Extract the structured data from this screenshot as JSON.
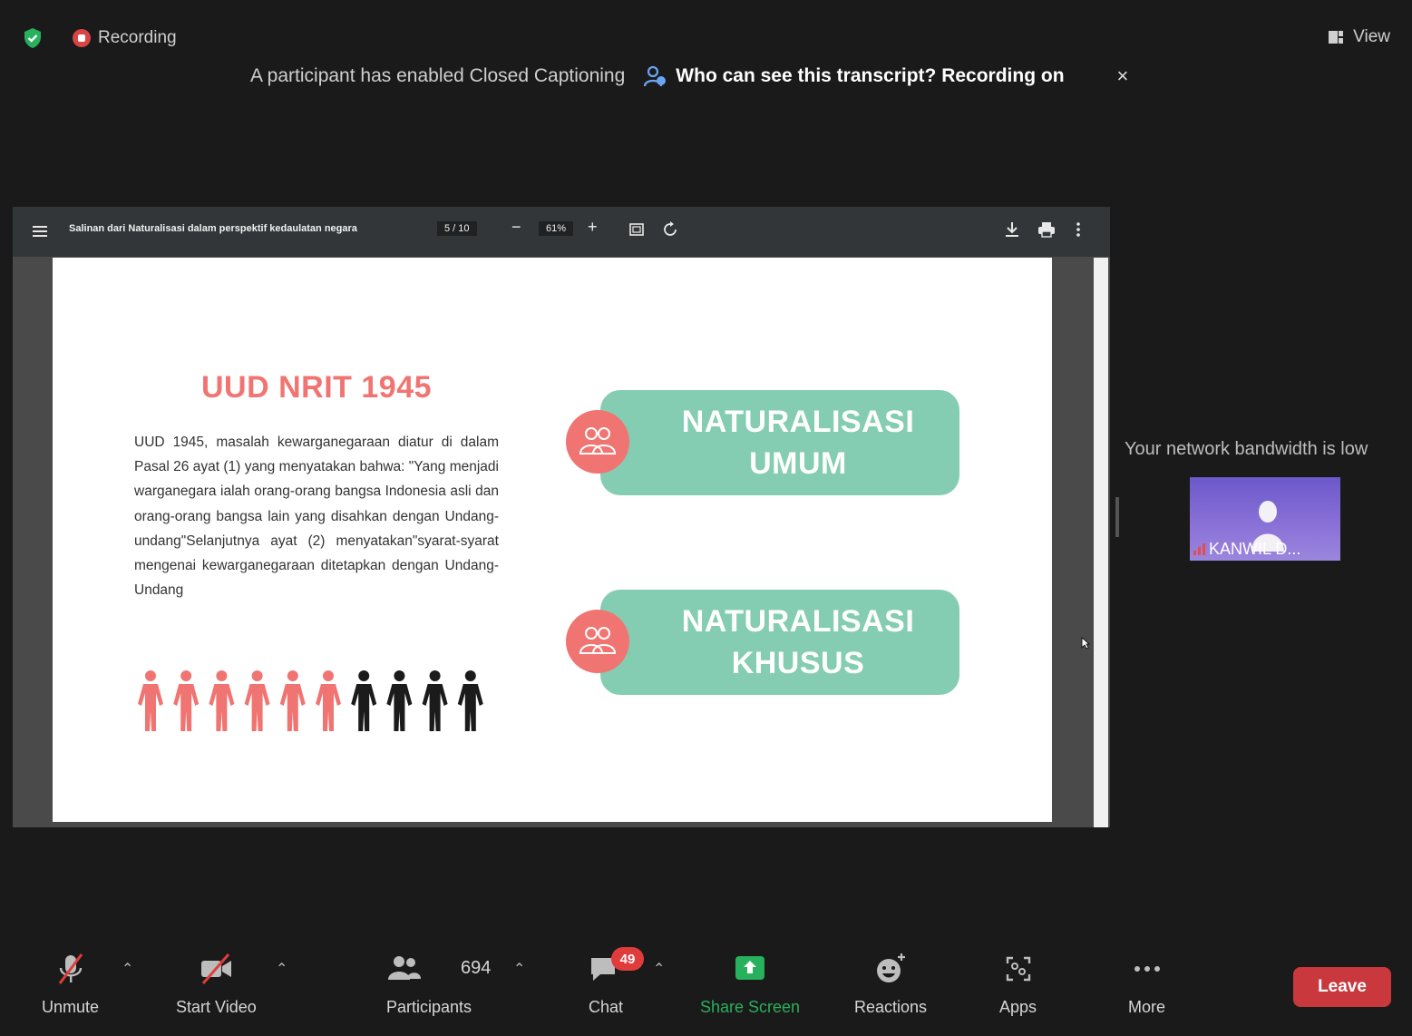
{
  "top": {
    "recording_label": "Recording",
    "view_label": "View",
    "caption_notice": "A participant has enabled Closed Captioning",
    "transcript_link": "Who can see this transcript? Recording on",
    "close_glyph": "×"
  },
  "pdf_viewer": {
    "file_name": "Salinan dari Naturalisasi dalam perspektif kedaulatan negara",
    "page_indicator": "5 / 10",
    "zoom": "61%",
    "minus": "−",
    "plus": "+"
  },
  "slide": {
    "title": "UUD NRIT 1945",
    "body": "UUD 1945, masalah kewarganegaraan diatur di dalam Pasal 26 ayat (1) yang menyatakan bahwa: \"Yang menjadi warganegara ialah orang-orang bangsa Indonesia asli dan orang-orang bangsa lain yang disahkan dengan Undang-undang\"Selanjutnya ayat (2) menyatakan\"syarat-syarat mengenai kewarganegaraan ditetapkan dengan Undang-Undang",
    "people_highlighted": 6,
    "people_total": 10,
    "badges": [
      {
        "line1": "NATURALISASI",
        "line2": "UMUM"
      },
      {
        "line1": "NATURALISASI",
        "line2": "KHUSUS"
      }
    ],
    "colors": {
      "accent": "#f07572",
      "badge": "#84cdb3"
    }
  },
  "side": {
    "network_notice": "Your network bandwidth is low",
    "participant_name": "KANWIL D..."
  },
  "toolbar": {
    "unmute": "Unmute",
    "start_video": "Start Video",
    "participants": "Participants",
    "participant_count": "694",
    "chat": "Chat",
    "chat_unread": "49",
    "share_screen": "Share Screen",
    "reactions": "Reactions",
    "apps": "Apps",
    "more": "More",
    "leave": "Leave"
  }
}
